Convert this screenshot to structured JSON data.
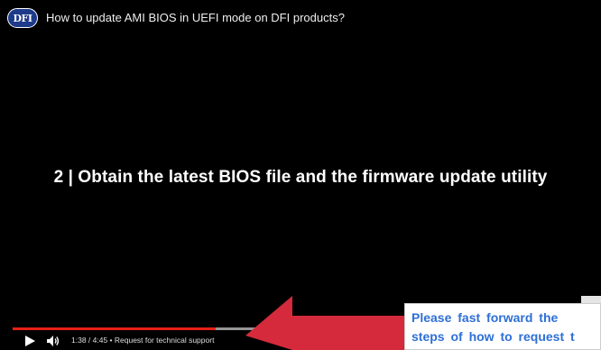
{
  "player": {
    "channel_logo_text": "DFI",
    "title": "How to update AMI BIOS in UEFI mode on DFI products?",
    "slide_caption": "2  |  Obtain the latest BIOS file and the firmware update utility",
    "progress": {
      "played_fraction": 0.352,
      "loaded_fraction": 0.44
    },
    "controls": {
      "play_icon": "play-icon",
      "volume_icon": "volume-icon",
      "time_display": "1:38 / 4:45 • Request for technical support"
    }
  },
  "annotation": {
    "arrow_color": "#d42a3c",
    "note_lines": [
      "Please fast forward the",
      "steps of how to request t"
    ]
  },
  "colors": {
    "accent_red": "#e62117",
    "note_text": "#2d6fd6",
    "logo_bg": "#1e3a8a"
  }
}
